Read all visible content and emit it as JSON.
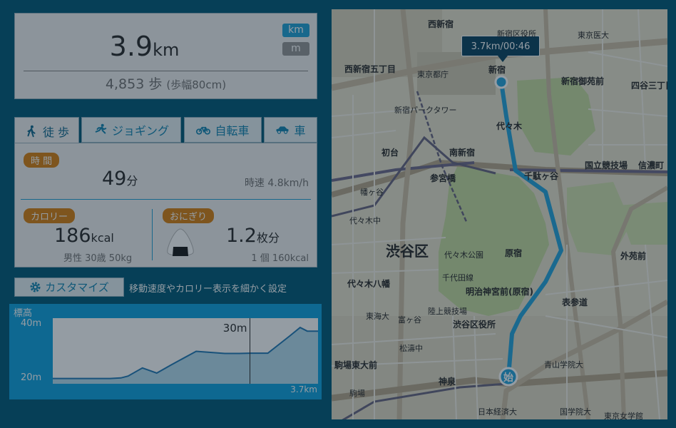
{
  "distance": {
    "value": "3.9",
    "unit": "km",
    "steps": "4,853 歩",
    "stride": "(歩幅80cm)"
  },
  "units": {
    "km": "km",
    "m": "m"
  },
  "tabs": [
    {
      "label": "徒 歩"
    },
    {
      "label": "ジョギング"
    },
    {
      "label": "自転車"
    },
    {
      "label": "車"
    }
  ],
  "stats": {
    "time_label": "時 間",
    "time_value": "49",
    "time_unit": "分",
    "speed": "時速 4.8km/h",
    "calorie_label": "カロリー",
    "calorie_value": "186",
    "calorie_unit": "kcal",
    "profile": "男性 30歳 50kg",
    "onigiri_label": "おにぎり",
    "onigiri_value": "1.2",
    "onigiri_unit": "枚分",
    "onigiri_note": "1 個 160kcal"
  },
  "customize": {
    "label": "カスタマイズ",
    "description": "移動速度やカロリー表示を細かく設定"
  },
  "elevation": {
    "title": "標高",
    "y_max_label": "40m",
    "y_min_label": "20m",
    "x_end_label": "3.7km",
    "cursor_label": "30m",
    "chart_data": {
      "type": "area",
      "title": "",
      "ylabel": "標高",
      "ylim": [
        20,
        40
      ],
      "xlim": [
        0,
        3.7
      ],
      "x": [
        0,
        0.3,
        0.8,
        0.95,
        1.05,
        1.25,
        1.45,
        1.65,
        2.0,
        2.4,
        2.6,
        2.75,
        3.0,
        3.3,
        3.45,
        3.55,
        3.7
      ],
      "y": [
        20.8,
        20.8,
        20.8,
        21.0,
        21.6,
        24.3,
        22.6,
        25.3,
        29.8,
        29.1,
        29.1,
        29.2,
        29.2,
        34.8,
        37.7,
        36.5,
        36.5
      ],
      "cursor_x": 2.75,
      "cursor_value": "30m",
      "colors": {
        "line": "#2a7fb8",
        "fill": "#b9dff0"
      }
    }
  },
  "map": {
    "tooltip": "3.7km/00:46",
    "start_marker": "始",
    "district_label": "渋谷区",
    "labels": [
      "西新宿",
      "西新宿五丁目",
      "東京都庁",
      "新宿",
      "新宿区役所",
      "東京医大",
      "新宿御苑前",
      "四谷三丁目",
      "新宿パークタワー",
      "初台",
      "南新宿",
      "代々木",
      "千駄ヶ谷",
      "国立競技場",
      "信濃町",
      "参宮橋",
      "幡ヶ谷",
      "代々木中",
      "代々木公園",
      "原宿",
      "外苑前",
      "代々木八幡",
      "明治神宮前(原宿)",
      "表参道",
      "渋谷区役所",
      "東海大",
      "富ヶ谷",
      "松濤中",
      "駒場東大前",
      "神泉",
      "青山学院大",
      "日本経済大",
      "国学院大",
      "東京女学館",
      "駒場",
      "陸上競技場",
      "千代田線"
    ]
  }
}
